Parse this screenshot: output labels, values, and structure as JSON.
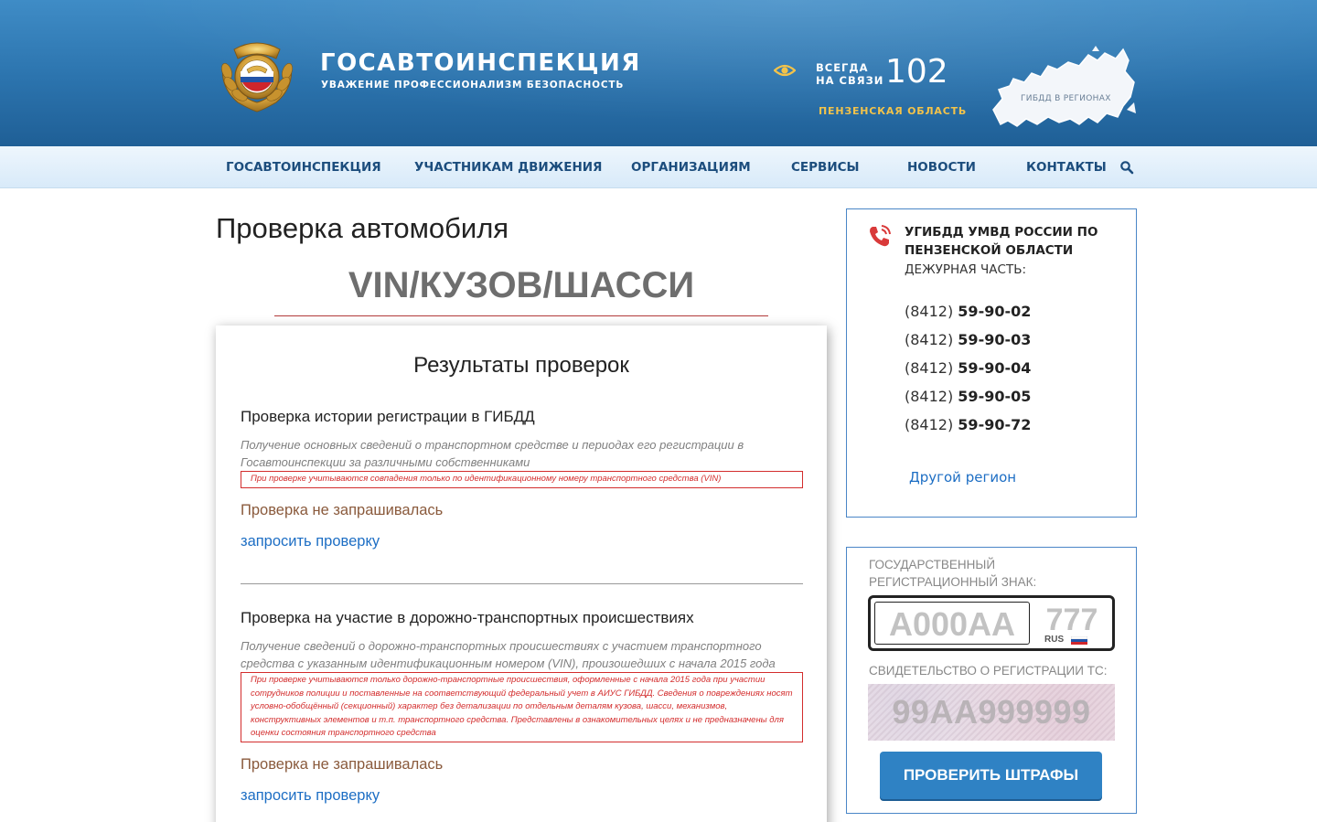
{
  "header": {
    "brand_title": "ГОСАВТОИНСПЕКЦИЯ",
    "brand_subtitle": "УВАЖЕНИЕ ПРОФЕССИОНАЛИЗМ БЕЗОПАСНОСТЬ",
    "always_line1": "ВСЕГДА",
    "always_line2": "НА СВЯЗИ",
    "hotline": "102",
    "region": "ПЕНЗЕНСКАЯ ОБЛАСТЬ",
    "map_label": "ГИБДД В РЕГИОНАХ",
    "emblem_icon": "traffic-police-emblem-icon",
    "eye_icon": "eye-icon",
    "colors": {
      "header_blue": "#2b73ad",
      "accent_yellow": "#f3c34a"
    }
  },
  "nav": {
    "items": [
      "ГОСАВТОИНСПЕКЦИЯ",
      "УЧАСТНИКАМ ДВИЖЕНИЯ",
      "ОРГАНИЗАЦИЯМ",
      "СЕРВИСЫ",
      "НОВОСТИ",
      "КОНТАКТЫ"
    ],
    "search_icon": "search-icon"
  },
  "main": {
    "page_title": "Проверка автомобиля",
    "vin_title": "VIN/КУЗОВ/ШАССИ",
    "results_title": "Результаты проверок",
    "sections": [
      {
        "title": "Проверка истории регистрации в ГИБДД",
        "desc": "Получение основных сведений о транспортном средстве и периодах его регистрации в Госавтоинспекции за различными собственниками",
        "note": "При проверке учитываются совпадения только по идентификационному номеру транспортного средства (VIN)",
        "status": "Проверка не запрашивалась",
        "link": "запросить проверку"
      },
      {
        "title": "Проверка на участие в дорожно-транспортных происшествиях",
        "desc": "Получение сведений о дорожно-транспортных происшествиях с участием транспортного средства с указанным идентификационным номером (VIN), произошедших с начала 2015 года",
        "note": "При проверке учитываются только дорожно-транспортные происшествия, оформленные с начала 2015 года при участии сотрудников полиции и поставленные на соответствующий федеральный учет в АИУС ГИБДД. Сведения о повреждениях носят условно-обобщённый (секционный) характер без детализации по отдельным деталям кузова, шасси, механизмов, конструктивных элементов и т.п. транспортного средства. Представлены в ознакомительных целях и не предназначены для оценки состояния транспортного средства",
        "status": "Проверка не запрашивалась",
        "link": "запросить проверку"
      }
    ],
    "colors": {
      "note_red": "#d32d2d",
      "link_blue": "#1d6ec4",
      "status_brown": "#8a5a3c"
    }
  },
  "contacts": {
    "phone_icon": "phone-icon",
    "dept_line1": "УГИБДД УМВД РОССИИ ПО",
    "dept_line2": "ПЕНЗЕНСКОЙ ОБЛАСТИ",
    "duty": "ДЕЖУРНАЯ ЧАСТЬ:",
    "phones": [
      {
        "code": "(8412)",
        "num": "59-90-02"
      },
      {
        "code": "(8412)",
        "num": "59-90-03"
      },
      {
        "code": "(8412)",
        "num": "59-90-04"
      },
      {
        "code": "(8412)",
        "num": "59-90-05"
      },
      {
        "code": "(8412)",
        "num": "59-90-72"
      }
    ],
    "other_region": "Другой регион"
  },
  "fines": {
    "plate_label_line1": "ГОСУДАРСТВЕННЫЙ",
    "plate_label_line2": "РЕГИСТРАЦИОННЫЙ ЗНАК:",
    "plate_placeholder": "А000АА",
    "region_placeholder": "777",
    "rus": "RUS",
    "cert_label": "СВИДЕТЕЛЬСТВО О РЕГИСТРАЦИИ ТС:",
    "cert_placeholder": "99АА999999",
    "button": "ПРОВЕРИТЬ ШТРАФЫ",
    "colors": {
      "button_blue": "#2f82c4"
    }
  }
}
